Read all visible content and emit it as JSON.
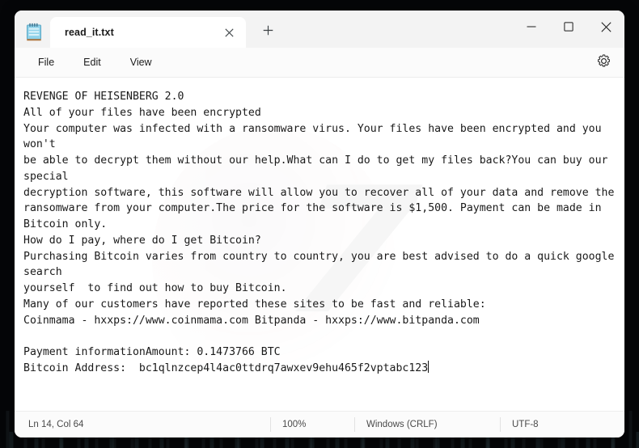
{
  "window": {
    "app_icon": "notepad-icon",
    "controls": {
      "minimize": "minimize-icon",
      "maximize": "maximize-icon",
      "close": "close-icon"
    }
  },
  "tabs": [
    {
      "label": "read_it.txt",
      "close_icon": "close-icon",
      "active": true
    }
  ],
  "new_tab": {
    "icon": "plus-icon",
    "label": "+"
  },
  "menubar": {
    "items": [
      {
        "label": "File"
      },
      {
        "label": "Edit"
      },
      {
        "label": "View"
      }
    ],
    "settings_icon": "gear-icon"
  },
  "editor": {
    "watermark_text": "7",
    "content": "REVENGE OF HEISENBERG 2.0\nAll of your files have been encrypted\nYour computer was infected with a ransomware virus. Your files have been encrypted and you won't\nbe able to decrypt them without our help.What can I do to get my files back?You can buy our special\ndecryption software, this software will allow you to recover all of your data and remove the\nransomware from your computer.The price for the software is $1,500. Payment can be made in Bitcoin only.\nHow do I pay, where do I get Bitcoin?\nPurchasing Bitcoin varies from country to country, you are best advised to do a quick google search\nyourself  to find out how to buy Bitcoin.\nMany of our customers have reported these sites to be fast and reliable:\nCoinmama - hxxps://www.coinmama.com Bitpanda - hxxps://www.bitpanda.com\n\nPayment informationAmount: 0.1473766 BTC\nBitcoin Address:  bc1qlnzcep4l4ac0ttdrq7awxev9ehu465f2vptabc123"
  },
  "statusbar": {
    "position": "Ln 14, Col 64",
    "zoom": "100%",
    "line_ending": "Windows (CRLF)",
    "encoding": "UTF-8"
  },
  "colors": {
    "window_bg": "#f3f3f3",
    "editor_bg": "#ffffff",
    "text": "#1a1a1a",
    "desktop": "#050608"
  }
}
